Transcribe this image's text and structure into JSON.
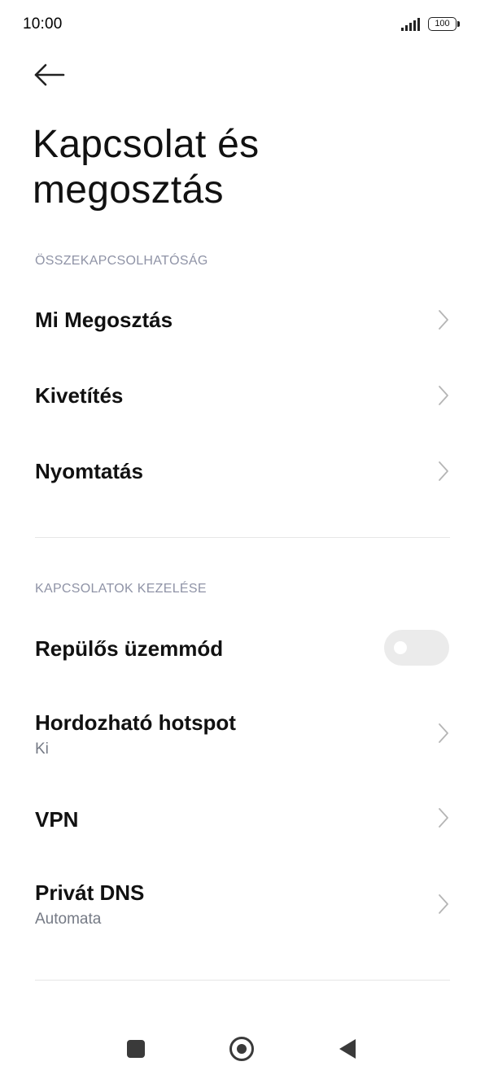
{
  "status_bar": {
    "time": "10:00",
    "battery": "100",
    "icons": [
      "signal-icon",
      "battery-icon"
    ]
  },
  "header": {
    "back_icon": "arrow-left-icon",
    "title": "Kapcsolat és megosztás"
  },
  "sections": [
    {
      "header": "ÖSSZEKAPCSOLHATÓSÁG",
      "items": [
        {
          "label": "Mi Megosztás"
        },
        {
          "label": "Kivetítés"
        },
        {
          "label": "Nyomtatás"
        }
      ]
    },
    {
      "header": "KAPCSOLATOK KEZELÉSE",
      "items": [
        {
          "label": "Repülős üzemmód",
          "toggle": false
        },
        {
          "label": "Hordozható hotspot",
          "sub": "Ki"
        },
        {
          "label": "VPN"
        },
        {
          "label": "Privát DNS",
          "sub": "Automata"
        }
      ]
    }
  ],
  "nav_bar": {
    "icons": [
      "recents-square-icon",
      "home-circle-icon",
      "back-triangle-icon"
    ]
  },
  "colors": {
    "section_header": "#8f93a6",
    "subtitle": "#757a85",
    "chevron": "#b5b5b5",
    "toggle_off": "#ebebeb"
  }
}
